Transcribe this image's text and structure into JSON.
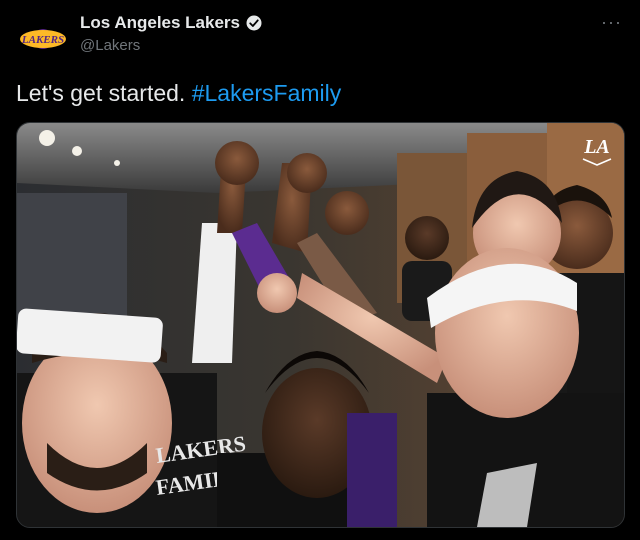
{
  "tweet": {
    "display_name": "Los Angeles Lakers",
    "handle": "@Lakers",
    "text_prefix": "Let's get started. ",
    "hashtag": "#LakersFamily",
    "more_label": "···",
    "avatar_logo_text": "LAKERS",
    "verified": true
  },
  "media": {
    "jersey_text_1": "LAKERS",
    "jersey_text_2": "FAMILY",
    "corner_logo_text": "LA"
  },
  "colors": {
    "background": "#000000",
    "text": "#e7e9ea",
    "secondary": "#71767b",
    "link": "#1d9bf0",
    "lakers_gold": "#fdb927",
    "lakers_purple": "#552583"
  }
}
